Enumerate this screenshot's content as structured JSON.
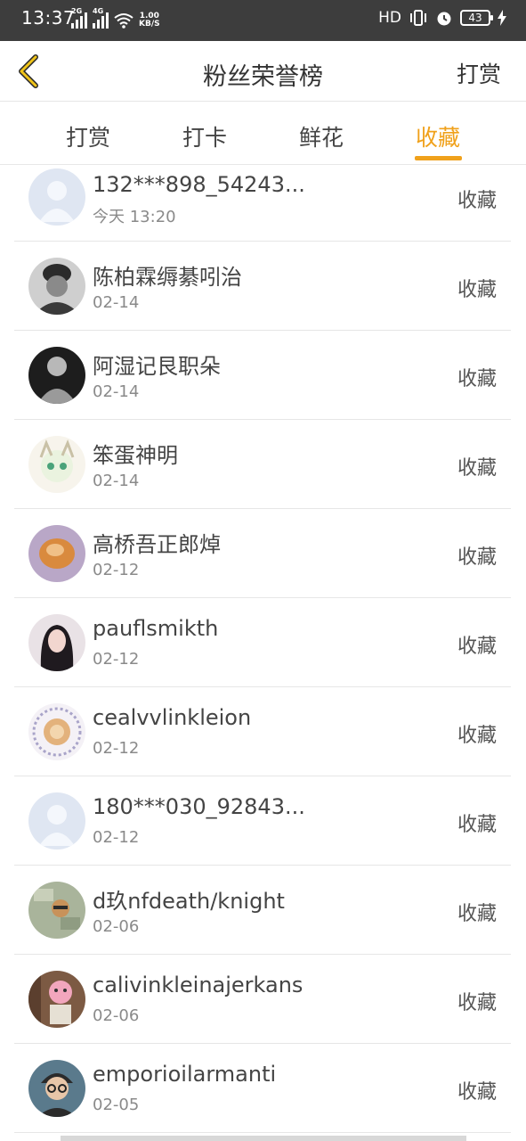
{
  "status_bar": {
    "time": "13:37",
    "net1": "2G",
    "net2": "4G",
    "speed_value": "1.00",
    "speed_unit": "KB/S",
    "hd": "HD",
    "battery": "43"
  },
  "header": {
    "title": "粉丝荣誉榜",
    "right_label": "打赏"
  },
  "tabs": [
    {
      "label": "打赏"
    },
    {
      "label": "打卡"
    },
    {
      "label": "鲜花"
    },
    {
      "label": "收藏"
    }
  ],
  "active_tab": "收藏",
  "accent_color": "#f0a11b",
  "rows": [
    {
      "name": "132***898_54243...",
      "date": "今天 13:20",
      "action": "收藏",
      "avatar": "default-avatar"
    },
    {
      "name": "陈柏霖缛綦吲治",
      "date": "02-14",
      "action": "收藏",
      "avatar": "photo-avatar"
    },
    {
      "name": "阿湿记艮职朵",
      "date": "02-14",
      "action": "收藏",
      "avatar": "photo-avatar"
    },
    {
      "name": "笨蛋神明",
      "date": "02-14",
      "action": "收藏",
      "avatar": "anime-avatar"
    },
    {
      "name": "高桥吾正郎焯",
      "date": "02-12",
      "action": "收藏",
      "avatar": "photo-avatar"
    },
    {
      "name": "pauflsmikth",
      "date": "02-12",
      "action": "收藏",
      "avatar": "photo-avatar"
    },
    {
      "name": "cealvvlinkleion",
      "date": "02-12",
      "action": "收藏",
      "avatar": "photo-avatar"
    },
    {
      "name": "180***030_92843...",
      "date": "02-12",
      "action": "收藏",
      "avatar": "default-avatar"
    },
    {
      "name": "d玖nfdeath/knight",
      "date": "02-06",
      "action": "收藏",
      "avatar": "photo-avatar"
    },
    {
      "name": "calivinkleinajerkans",
      "date": "02-06",
      "action": "收藏",
      "avatar": "photo-avatar"
    },
    {
      "name": "emporioilarmanti",
      "date": "02-05",
      "action": "收藏",
      "avatar": "photo-avatar"
    }
  ]
}
